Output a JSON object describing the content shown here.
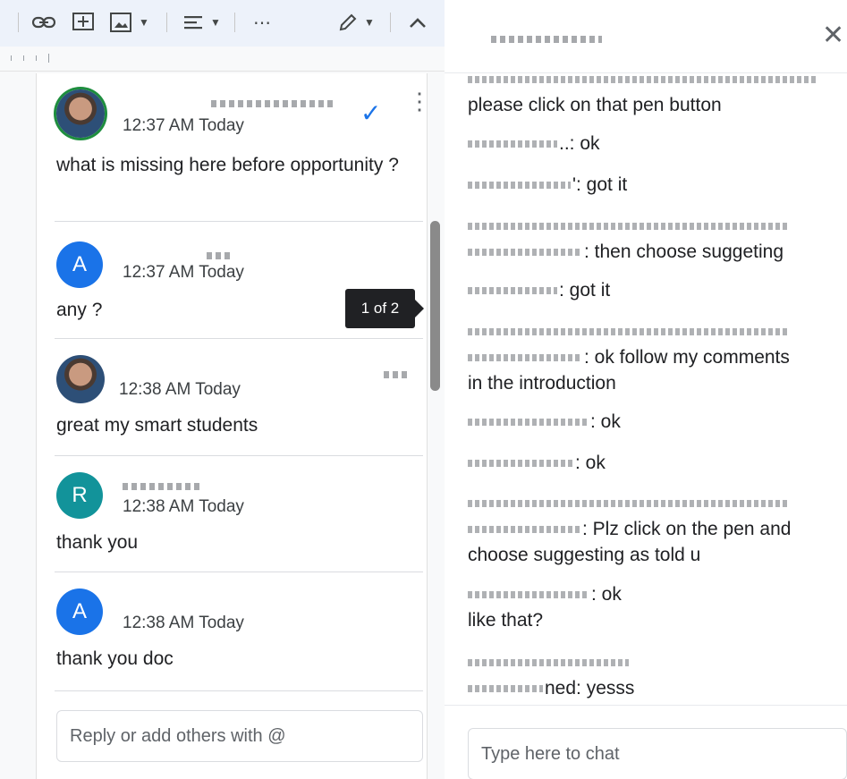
{
  "toolbar": {
    "icons": [
      "link-icon",
      "add-comment-icon",
      "image-icon",
      "align-icon",
      "more-icon",
      "edit-mode-icon",
      "collapse-icon"
    ],
    "more_glyph": "⋯"
  },
  "comments": {
    "items": [
      {
        "time": "12:37 AM Today",
        "text": "what is missing here before opportunity ?"
      },
      {
        "avatar_letter": "A",
        "time": "12:37 AM Today",
        "text": "any ?"
      },
      {
        "time": "12:38 AM Today",
        "text": "great my smart students"
      },
      {
        "avatar_letter": "R",
        "time": "12:38 AM Today",
        "text": "thank you"
      },
      {
        "avatar_letter": "A",
        "time": "12:38 AM Today",
        "text": "thank you doc"
      }
    ],
    "tooltip": "1 of 2",
    "reply_placeholder": "Reply or add others with @",
    "accent": "#1a73e8"
  },
  "chat": {
    "messages": [
      {
        "line1": "please  click on that  pen  button"
      },
      {
        "suffix": "..: ok"
      },
      {
        "suffix": "': got it"
      },
      {
        "suffix": ": then choose suggeting"
      },
      {
        "suffix": ": got it"
      },
      {
        "suffix": ": ok follow  my comments",
        "line2": "in the introduction"
      },
      {
        "suffix": ": ok"
      },
      {
        "suffix": ": ok"
      },
      {
        "suffix": ": Plz click on the pen and",
        "line2": "choose suggesting as told u"
      },
      {
        "suffix": ": ok",
        "line2": "like that?"
      },
      {
        "suffix": "ned: yesss"
      }
    ],
    "input_placeholder": "Type here to chat",
    "close_glyph": "✕"
  }
}
